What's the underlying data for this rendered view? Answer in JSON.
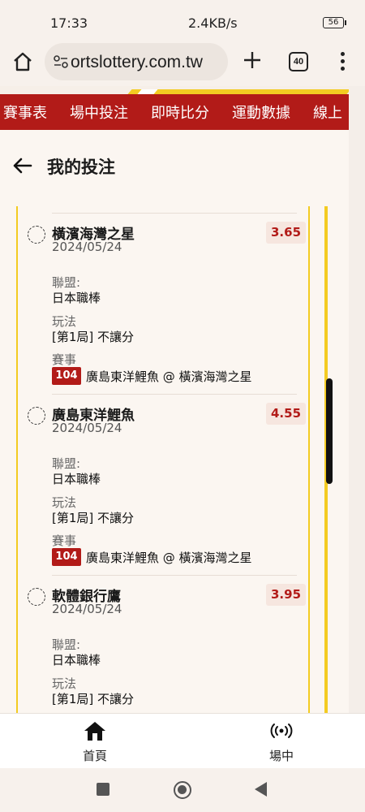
{
  "status_bar": {
    "time": "17:33",
    "net_speed": "2.4KB/s",
    "battery": "56"
  },
  "browser": {
    "url": "ortslottery.com.tw",
    "tab_count": "40"
  },
  "nav": {
    "items": [
      "賽事表",
      "場中投注",
      "即時比分",
      "運動數據",
      "線上"
    ]
  },
  "header": {
    "title": "我的投注"
  },
  "bets": [
    {
      "team": "橫濱海灣之星",
      "date": "2024/05/24",
      "odds": "3.65",
      "league_label": "聯盟:",
      "league": "日本職棒",
      "play_label": "玩法",
      "play": "[第1局] 不讓分",
      "match_label": "賽事",
      "match_no": "104",
      "match": "廣島東洋鯉魚 @ 橫濱海灣之星"
    },
    {
      "team": "廣島東洋鯉魚",
      "date": "2024/05/24",
      "odds": "4.55",
      "league_label": "聯盟:",
      "league": "日本職棒",
      "play_label": "玩法",
      "play": "[第1局] 不讓分",
      "match_label": "賽事",
      "match_no": "104",
      "match": "廣島東洋鯉魚 @ 橫濱海灣之星"
    },
    {
      "team": "軟體銀行鷹",
      "date": "2024/05/24",
      "odds": "3.95",
      "league_label": "聯盟:",
      "league": "日本職棒",
      "play_label": "玩法",
      "play": "[第1局] 不讓分",
      "match_label": "賽事",
      "match_no": "",
      "match": ""
    }
  ],
  "bottom_nav": {
    "home_label": "首頁",
    "live_label": "場中"
  },
  "colors": {
    "brand_red": "#b21b18",
    "accent_yellow": "#f3cb22"
  }
}
